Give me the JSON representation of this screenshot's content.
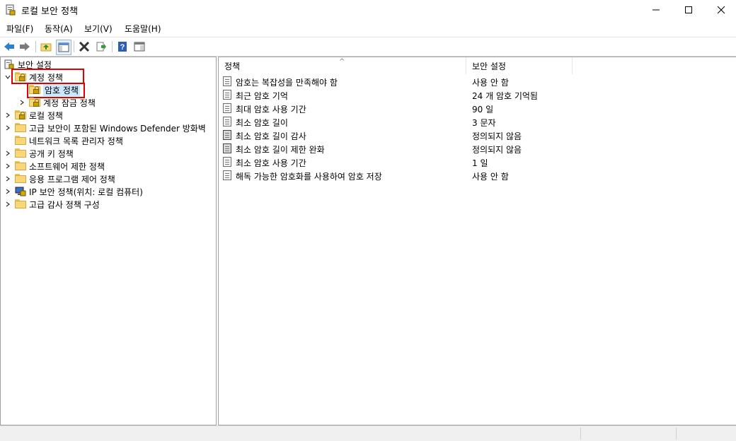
{
  "window": {
    "title": "로컬 보안 정책"
  },
  "menu": [
    "파일(F)",
    "동작(A)",
    "보기(V)",
    "도움말(H)"
  ],
  "tree": {
    "root": "보안 설정",
    "items": [
      {
        "label": "계정 정책",
        "level": 1,
        "expanded": true
      },
      {
        "label": "암호 정책",
        "level": 2,
        "selected": true
      },
      {
        "label": "계정 잠금 정책",
        "level": 2
      },
      {
        "label": "로컬 정책",
        "level": 1
      },
      {
        "label": "고급 보안이 포함된 Windows Defender 방화벽",
        "level": 1
      },
      {
        "label": "네트워크 목록 관리자 정책",
        "level": 1
      },
      {
        "label": "공개 키 정책",
        "level": 1
      },
      {
        "label": "소프트웨어 제한 정책",
        "level": 1
      },
      {
        "label": "응용 프로그램 제어 정책",
        "level": 1
      },
      {
        "label": "IP 보안 정책(위치: 로컬 컴퓨터)",
        "level": 1
      },
      {
        "label": "고급 감사 정책 구성",
        "level": 1
      }
    ]
  },
  "list": {
    "headers": {
      "policy": "정책",
      "setting": "보안 설정"
    },
    "rows": [
      {
        "policy": "암호는 복잡성을 만족해야 함",
        "setting": "사용 안 함"
      },
      {
        "policy": "최근 암호 기억",
        "setting": "24 개 암호 기억됨"
      },
      {
        "policy": "최대 암호 사용 기간",
        "setting": "90 일"
      },
      {
        "policy": "최소 암호 길이",
        "setting": "3 문자"
      },
      {
        "policy": "최소 암호 길이 감사",
        "setting": "정의되지 않음"
      },
      {
        "policy": "최소 암호 길이 제한 완화",
        "setting": "정의되지 않음"
      },
      {
        "policy": "최소 암호 사용 기간",
        "setting": "1 일"
      },
      {
        "policy": "해독 가능한 암호화를 사용하여 암호 저장",
        "setting": "사용 안 함"
      }
    ]
  },
  "colors": {
    "highlight": "#e00000",
    "selection": "#cce8ff"
  }
}
